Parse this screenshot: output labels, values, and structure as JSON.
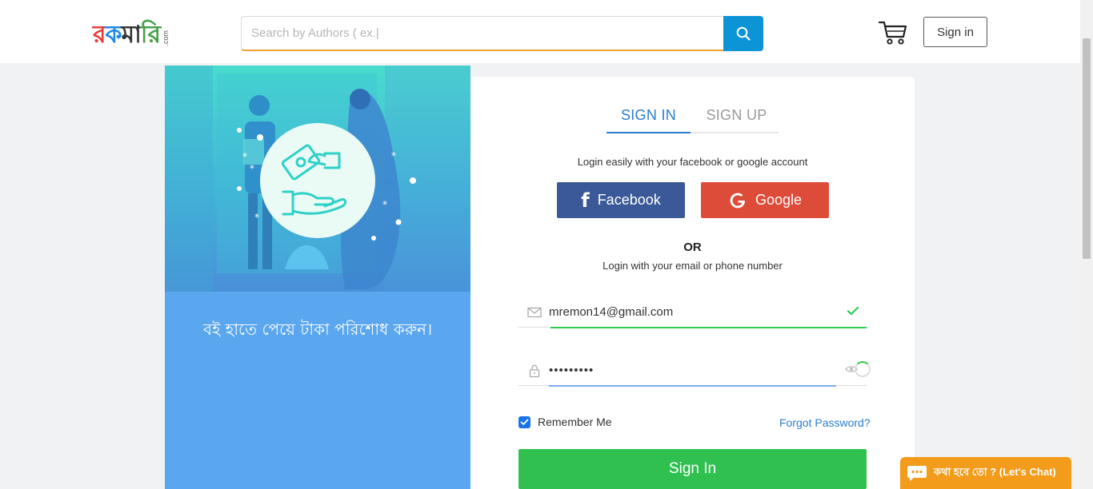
{
  "header": {
    "logo": {
      "text_parts": [
        "র",
        "ক",
        "মা",
        "রি"
      ],
      "suffix": ".com"
    },
    "search": {
      "placeholder": "Search by Authors ( ex.|",
      "value": ""
    },
    "signin_label": "Sign in",
    "icons": {
      "search": "search-icon",
      "cart": "cart-icon"
    }
  },
  "left_panel": {
    "caption": "বই হাতে পেয়ে টাকা পরিশোধ করুন।",
    "illustration": "cash-on-delivery-hands-icon"
  },
  "login_card": {
    "tabs": [
      {
        "label": "SIGN IN",
        "active": true
      },
      {
        "label": "SIGN UP",
        "active": false
      }
    ],
    "social_prompt": "Login easily with your facebook or google account",
    "facebook_label": "Facebook",
    "google_label": "Google",
    "or_label": "OR",
    "email_prompt": "Login with your email or phone number",
    "email_value": "mremon14@gmail.com",
    "password_value": "•••••••••",
    "remember_label": "Remember Me",
    "remember_checked": true,
    "forgot_label": "Forgot Password?",
    "submit_label": "Sign In"
  },
  "chat_widget": {
    "label": "কথা হবে তো ? (Let's Chat)"
  },
  "colors": {
    "accent_blue": "#0d94d6",
    "facebook": "#3b5998",
    "google": "#dd4b39",
    "success": "#30c04f",
    "chat": "#f39b1a",
    "panel": "#5aa6ef"
  }
}
